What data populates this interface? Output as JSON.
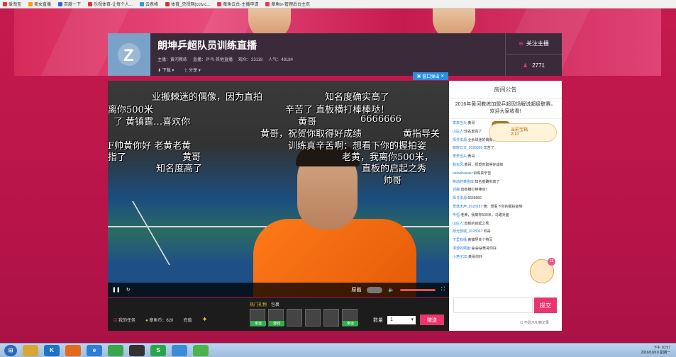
{
  "bookmarks": [
    "爱淘宝",
    "美女直播",
    "百度一下",
    "乐视体育-让每个人...",
    "云表格",
    "体育_央视网(cctv.c...",
    "章鱼云台-主播申请",
    "章鱼tv-管理后台主页"
  ],
  "room": {
    "title": "朗坤乒超队员训练直播",
    "host": "主播：黄河教练",
    "channel": "直播：乒乓·其他直播",
    "views": "观众：23118",
    "popularity": "人气：48184",
    "download": "下载",
    "share": "分享",
    "follow": "关注主播",
    "fans": "2771"
  },
  "popout": "窗口弹出",
  "danmaku": [
    "业搬棘迷的偶像，因为直拍",
    "知名度确实高了",
    "离你500米",
    "辛苦了 直板横打棒棒哒！",
    "了 黄镇霆…喜欢你",
    "黄哥",
    "6666666",
    "黄哥，祝贺你取得好成绩",
    "黄指导关",
    "F帅黄你好 老黄老黄",
    "训练真辛苦啊：想看下你的握拍姿",
    "指了",
    "黄哥",
    "老黄，我离你500米，",
    "知名度高了",
    "直板的启起之秀",
    "帅哥"
  ],
  "video_ctrl": {
    "quality": "原画"
  },
  "gifts": {
    "tab_hot": "热门礼物",
    "tab_pack": "包裹",
    "my_task": "我的任务",
    "coins": "章鱼币：620",
    "recharge": "充值",
    "quantity_label": "数量",
    "quantity": "1",
    "send": "赠送",
    "labels": [
      "幸运",
      "游戏",
      "",
      "",
      "",
      "幸运"
    ]
  },
  "sidebar": {
    "title": "房间公告",
    "notice": "2016年黄河教练加盟乒超现场解说超级联赛，欢迎大家收看!",
    "treasure_title": "当前宝箱",
    "treasure_count": "2/10",
    "star_count": "18",
    "send": "提交",
    "no_gift": "不显示礼物记录",
    "chat": [
      {
        "u": "李李当头:",
        "t": "黄哥"
      },
      {
        "u": "山庄人:",
        "t": "知名度高了"
      },
      {
        "u": "探寻本源:",
        "t": "业余球迷的偶像，因为直拍"
      },
      {
        "u": "敏晓云天_2028305:",
        "t": "辛苦了"
      },
      {
        "u": "李李当头:",
        "t": "黄哥"
      },
      {
        "u": "我东风:",
        "t": "黄哥，祝贺你取得好成绩"
      },
      {
        "u": "natashaxiaxi:",
        "t": "训练真辛苦"
      },
      {
        "u": "移动的菜金库:",
        "t": "知名度确实高了"
      },
      {
        "u": "邻静:",
        "t": "直板横打棒棒哒！"
      },
      {
        "u": "探寻本源:",
        "t": "6666666"
      },
      {
        "u": "雪落无声_2028187:",
        "t": "黄：想看下你的握拍姿势"
      },
      {
        "u": "毕恒:",
        "t": "老黄，我离你500米，马路对面"
      },
      {
        "u": "山庄人:",
        "t": "直板的启起之秀"
      },
      {
        "u": "阳光部城_2028067:",
        "t": "帅哥"
      },
      {
        "u": "干里有缘:",
        "t": "黄镇导关个特写"
      },
      {
        "u": "漫游的鳄鱼:",
        "t": "😀😀😀黄哥你好"
      },
      {
        "u": "小燕子22:",
        "t": "黄哥你好"
      }
    ]
  },
  "taskbar": {
    "time": "下午 10:57",
    "date": "2016/10/10 星期一"
  }
}
